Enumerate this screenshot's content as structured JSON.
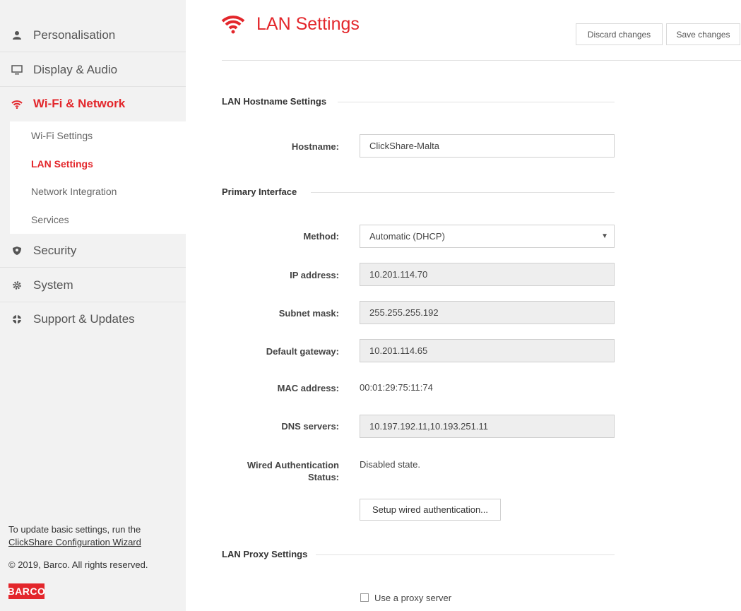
{
  "sidebar": {
    "items": [
      {
        "label": "Personalisation",
        "icon": "person-icon"
      },
      {
        "label": "Display & Audio",
        "icon": "monitor-icon"
      },
      {
        "label": "Wi-Fi & Network",
        "icon": "wifi-icon"
      },
      {
        "label": "Security",
        "icon": "shield-icon"
      },
      {
        "label": "System",
        "icon": "gear-icon"
      },
      {
        "label": "Support & Updates",
        "icon": "lifebuoy-icon"
      }
    ],
    "subitems": [
      {
        "label": "Wi-Fi Settings"
      },
      {
        "label": "LAN Settings"
      },
      {
        "label": "Network Integration"
      },
      {
        "label": "Services"
      }
    ],
    "footer": {
      "update_text": "To update basic settings, run the",
      "wizard_link": "ClickShare Configuration Wizard",
      "copyright": "© 2019, Barco. All rights reserved.",
      "logo_text": "BARCO"
    }
  },
  "header": {
    "title": "LAN Settings",
    "discard_label": "Discard changes",
    "save_label": "Save changes"
  },
  "sections": {
    "hostname_title": "LAN Hostname Settings",
    "primary_title": "Primary Interface",
    "proxy_title": "LAN Proxy Settings"
  },
  "form": {
    "hostname_label": "Hostname:",
    "hostname_value": "ClickShare-Malta",
    "method_label": "Method:",
    "method_value": "Automatic (DHCP)",
    "ip_label": "IP address:",
    "ip_value": "10.201.114.70",
    "subnet_label": "Subnet mask:",
    "subnet_value": "255.255.255.192",
    "gateway_label": "Default gateway:",
    "gateway_value": "10.201.114.65",
    "mac_label": "MAC address:",
    "mac_value": "00:01:29:75:11:74",
    "dns_label": "DNS servers:",
    "dns_value": "10.197.192.11,10.193.251.11",
    "auth_label_line1": "Wired Authentication",
    "auth_label_line2": "Status:",
    "auth_value": "Disabled state.",
    "setup_button": "Setup wired authentication...",
    "proxy_checkbox_label": "Use a proxy server"
  },
  "colors": {
    "accent": "#e3262b",
    "sidebar_bg": "#f2f2f2",
    "readonly_bg": "#eeeeee"
  }
}
